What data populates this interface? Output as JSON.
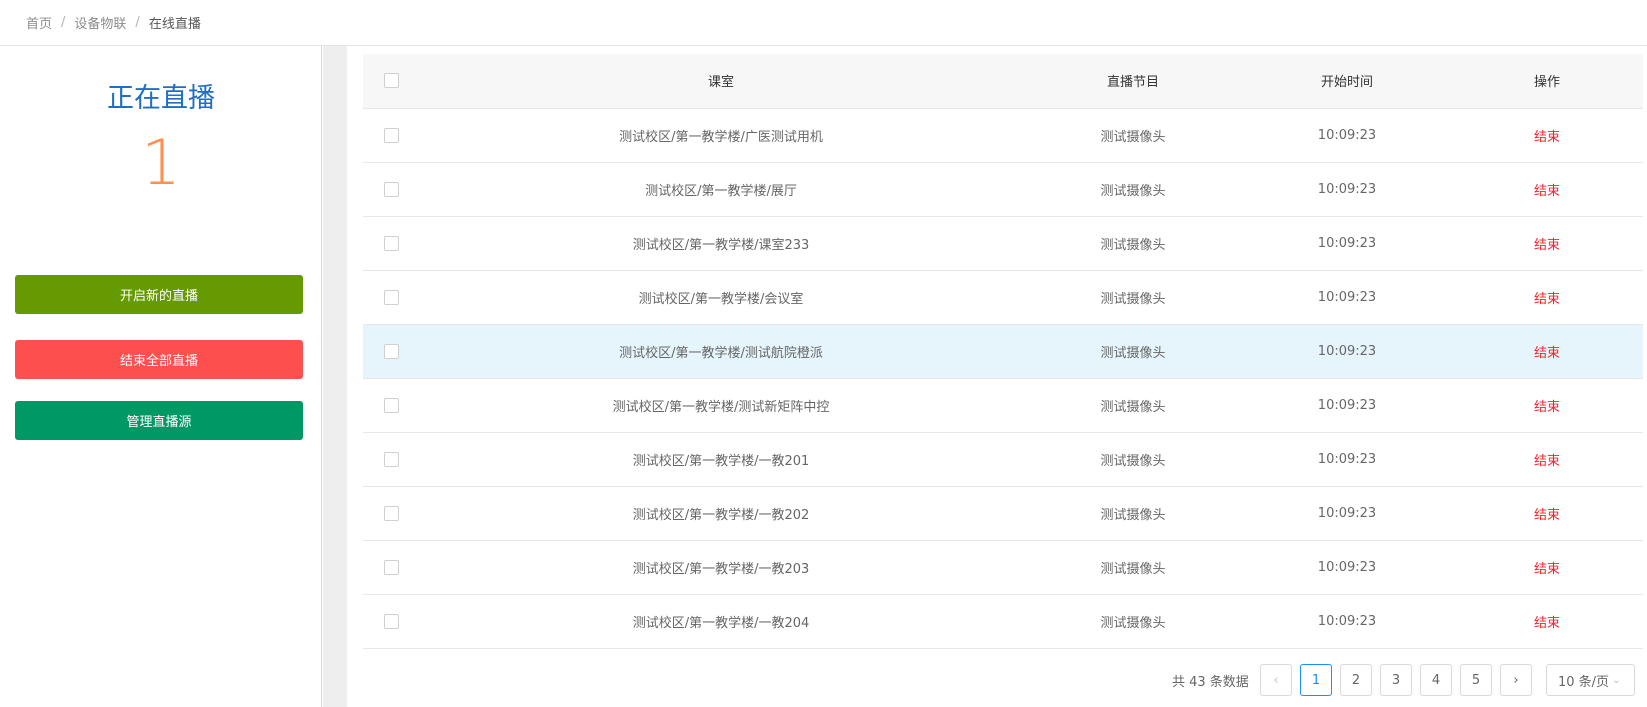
{
  "breadcrumb": {
    "home": "首页",
    "section": "设备物联",
    "current": "在线直播",
    "separator": "/"
  },
  "status": {
    "title": "正在直播",
    "count": "1"
  },
  "actions": {
    "start_label": "开启新的直播",
    "end_all_label": "结束全部直播",
    "manage_label": "管理直播源"
  },
  "table": {
    "headers": {
      "room": "课室",
      "program": "直播节目",
      "start_time": "开始时间",
      "operation": "操作"
    },
    "rows": [
      {
        "room": "测试校区/第一教学楼/广医测试用机",
        "program": "测试摄像头",
        "start_time": "10:09:23",
        "action": "结束"
      },
      {
        "room": "测试校区/第一教学楼/展厅",
        "program": "测试摄像头",
        "start_time": "10:09:23",
        "action": "结束"
      },
      {
        "room": "测试校区/第一教学楼/课室233",
        "program": "测试摄像头",
        "start_time": "10:09:23",
        "action": "结束"
      },
      {
        "room": "测试校区/第一教学楼/会议室",
        "program": "测试摄像头",
        "start_time": "10:09:23",
        "action": "结束"
      },
      {
        "room": "测试校区/第一教学楼/测试航院橙派",
        "program": "测试摄像头",
        "start_time": "10:09:23",
        "action": "结束"
      },
      {
        "room": "测试校区/第一教学楼/测试新矩阵中控",
        "program": "测试摄像头",
        "start_time": "10:09:23",
        "action": "结束"
      },
      {
        "room": "测试校区/第一教学楼/一教201",
        "program": "测试摄像头",
        "start_time": "10:09:23",
        "action": "结束"
      },
      {
        "room": "测试校区/第一教学楼/一教202",
        "program": "测试摄像头",
        "start_time": "10:09:23",
        "action": "结束"
      },
      {
        "room": "测试校区/第一教学楼/一教203",
        "program": "测试摄像头",
        "start_time": "10:09:23",
        "action": "结束"
      },
      {
        "room": "测试校区/第一教学楼/一教204",
        "program": "测试摄像头",
        "start_time": "10:09:23",
        "action": "结束"
      }
    ]
  },
  "pagination": {
    "total_text": "共 43 条数据",
    "pages": [
      "1",
      "2",
      "3",
      "4",
      "5"
    ],
    "current_page": "1",
    "prev_icon": "‹",
    "next_icon": "›",
    "page_size": "10 条/页"
  },
  "colors": {
    "title_blue": "#1f6fc4",
    "count_orange": "#ff8f4d",
    "start_green": "#659a00",
    "end_red": "#fe4f4f",
    "manage_green": "#009966",
    "row_highlight": "#e6f5fc"
  }
}
